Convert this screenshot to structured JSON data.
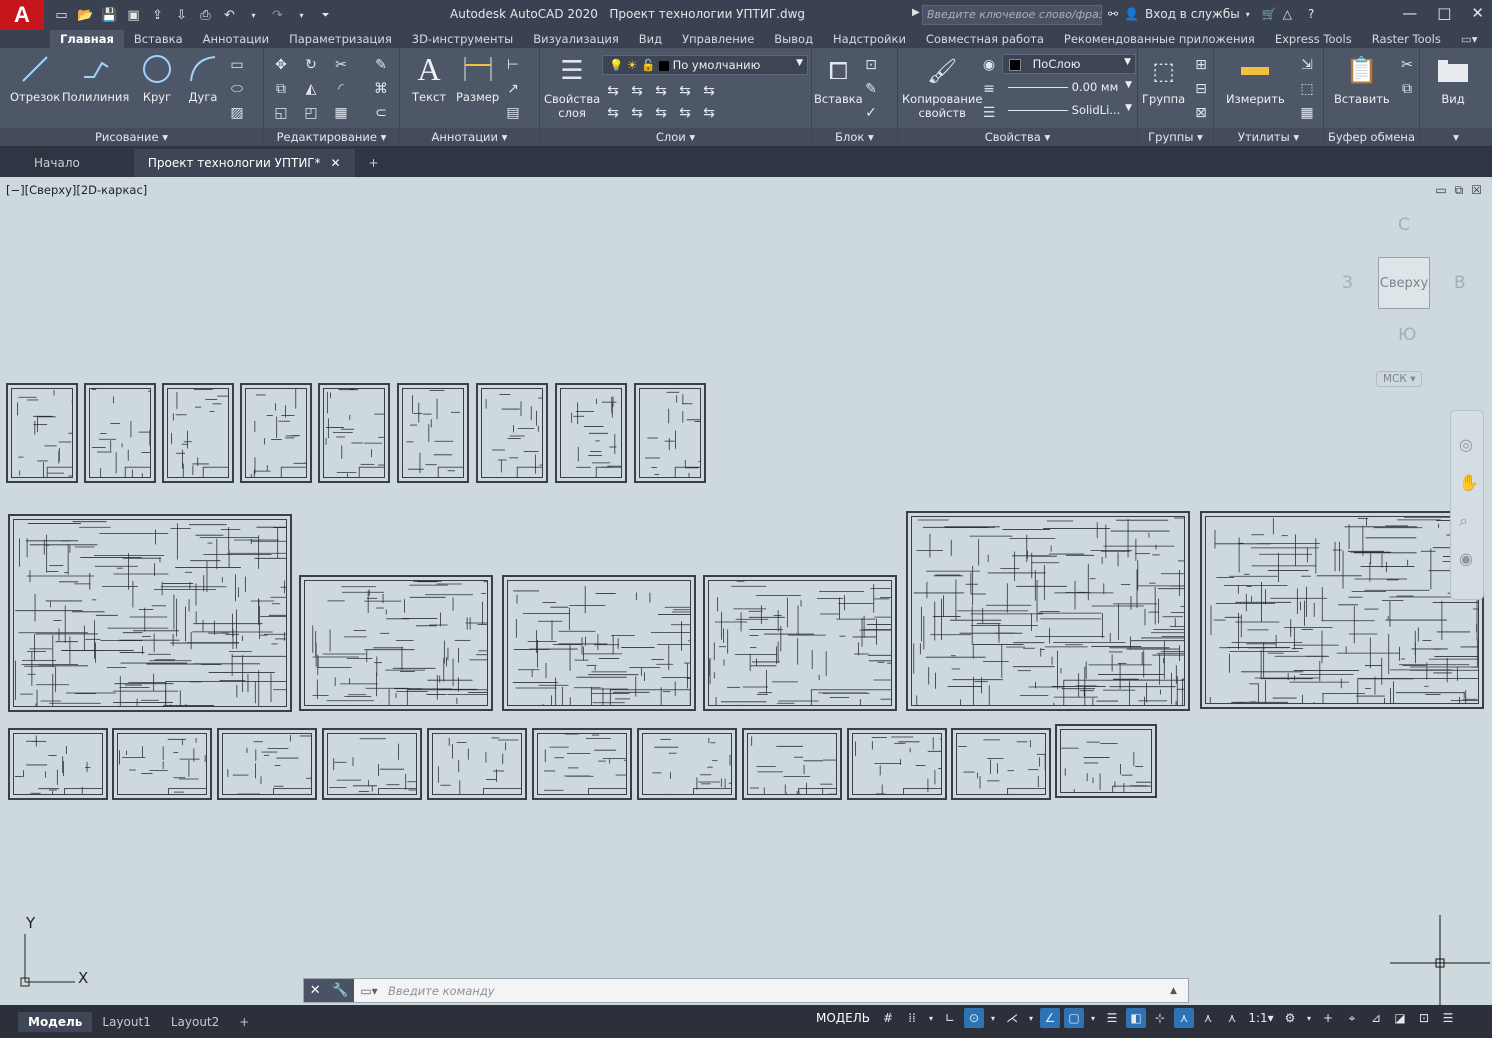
{
  "app": {
    "title": "Autodesk AutoCAD 2020",
    "file": "Проект технологии УПТИГ.dwg",
    "logo_letter": "A",
    "brand_color": "#c4161c"
  },
  "search": {
    "placeholder": "Введите ключевое слово/фразу"
  },
  "account": {
    "signin": "Вход в службы"
  },
  "ribbon_tabs": [
    "Главная",
    "Вставка",
    "Аннотации",
    "Параметризация",
    "3D-инструменты",
    "Визуализация",
    "Вид",
    "Управление",
    "Вывод",
    "Надстройки",
    "Совместная работа",
    "Рекомендованные приложения",
    "Express Tools",
    "Raster Tools"
  ],
  "active_tab": "Главная",
  "draw": {
    "line": "Отрезок",
    "polyline": "Полилиния",
    "circle": "Круг",
    "arc": "Дуга",
    "footer": "Рисование"
  },
  "modify": {
    "footer": "Редактирование"
  },
  "annotation": {
    "text": "Текст",
    "dimension": "Размер",
    "footer": "Аннотации"
  },
  "layers": {
    "props_line1": "Свойства",
    "props_line2": "слоя",
    "current": "По умолчанию",
    "footer": "Слои"
  },
  "block": {
    "insert": "Вставка",
    "footer": "Блок"
  },
  "properties": {
    "match_line1": "Копирование",
    "match_line2": "свойств",
    "color": "ПоСлою",
    "lineweight": "0.00 мм",
    "linetype": "SolidLi...",
    "footer": "Свойства"
  },
  "groups": {
    "group": "Группа",
    "footer": "Группы"
  },
  "utilities": {
    "measure": "Измерить",
    "footer": "Утилиты"
  },
  "clipboard": {
    "paste": "Вставить",
    "footer": "Буфер обмена"
  },
  "view": {
    "label": "Вид"
  },
  "doc_tabs": {
    "start": "Начало",
    "current": "Проект технологии УПТИГ*"
  },
  "viewport": {
    "label": "[−][Сверху][2D-каркас]"
  },
  "viewcube": {
    "north": "С",
    "south": "Ю",
    "west": "З",
    "east": "В",
    "face": "Сверху",
    "wcs": "МСК"
  },
  "ucs": {
    "x": "X",
    "y": "Y"
  },
  "command": {
    "placeholder": "Введите команду"
  },
  "layouts": [
    "Модель",
    "Layout1",
    "Layout2"
  ],
  "status": {
    "model": "МОДЕЛЬ",
    "scale": "1:1"
  }
}
